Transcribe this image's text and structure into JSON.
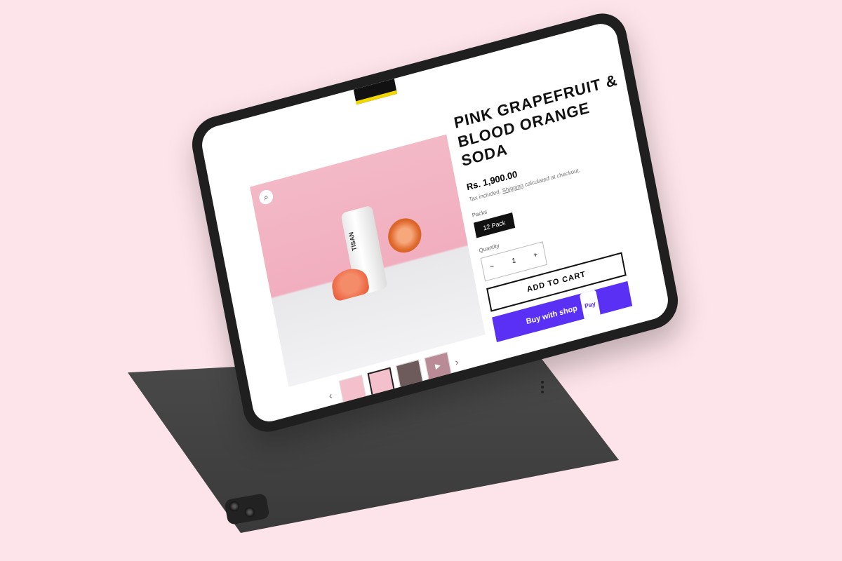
{
  "product": {
    "title": "PINK GRAPEFRUIT & BLOOD ORANGE SODA",
    "price": "Rs. 1,900.00",
    "tax_text": "Tax included.",
    "shipping_link": "Shipping",
    "shipping_suffix": "calculated at checkout.",
    "packs_label": "Packs",
    "pack_option": "12 Pack",
    "quantity_label": "Quantity",
    "quantity_value": "1",
    "add_to_cart": "ADD TO CART",
    "buy_with": "Buy with",
    "shop_word": "shop",
    "pay_word": "Pay",
    "can_brand": "TISAN"
  },
  "colors": {
    "background": "#fde4ea",
    "shop_pay": "#5a31f4",
    "accent": "#f2d600"
  }
}
